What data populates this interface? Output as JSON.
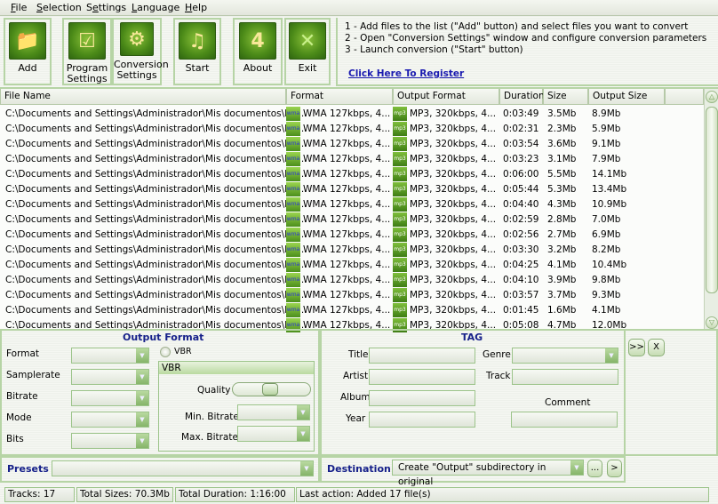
{
  "menu": [
    {
      "label": "File",
      "accel": "F",
      "rest": "ile"
    },
    {
      "label": "Selection",
      "accel": "S",
      "rest": "election"
    },
    {
      "label": "Settings",
      "accel": "e",
      "pre": "S",
      "rest": "ttings"
    },
    {
      "label": "Language",
      "accel": "L",
      "rest": "anguage"
    },
    {
      "label": "Help",
      "accel": "H",
      "rest": "elp"
    }
  ],
  "toolbar": {
    "add": {
      "label": "Add",
      "icon": "add-folder-music-icon"
    },
    "program_settings": {
      "line1": "Program",
      "line2": "Settings",
      "icon": "program-settings-icon"
    },
    "conversion_settings": {
      "line1": "Conversion",
      "line2": "Settings",
      "icon": "conversion-settings-icon"
    },
    "start": {
      "label": "Start",
      "icon": "start-music-icon"
    },
    "about": {
      "label": "About",
      "icon": "about-icon"
    },
    "exit": {
      "label": "Exit",
      "icon": "exit-icon"
    }
  },
  "info": {
    "step1": "1 - Add files to the list (\"Add\" button) and select files you want to convert",
    "step2": "2 - Open \"Conversion Settings\" window and configure conversion parameters",
    "step3": "3 - Launch conversion (\"Start\" button)",
    "register": "Click Here To Register"
  },
  "columns": [
    "File Name",
    "Format",
    "Output Format",
    "Duration",
    "Size",
    "Output Size"
  ],
  "files": [
    {
      "name": "C:\\Documents and Settings\\Administrador\\Mis documentos\\Mi ...",
      "format": "WMA 127kbps, 4...",
      "output_format": "MP3, 320kbps, 4...",
      "duration": "0:03:49",
      "size": "3.5Mb",
      "output_size": "8.9Mb"
    },
    {
      "name": "C:\\Documents and Settings\\Administrador\\Mis documentos\\Mi ...",
      "format": "WMA 127kbps, 4...",
      "output_format": "MP3, 320kbps, 4...",
      "duration": "0:02:31",
      "size": "2.3Mb",
      "output_size": "5.9Mb"
    },
    {
      "name": "C:\\Documents and Settings\\Administrador\\Mis documentos\\Mi ...",
      "format": "WMA 127kbps, 4...",
      "output_format": "MP3, 320kbps, 4...",
      "duration": "0:03:54",
      "size": "3.6Mb",
      "output_size": "9.1Mb"
    },
    {
      "name": "C:\\Documents and Settings\\Administrador\\Mis documentos\\Mi ...",
      "format": "WMA 127kbps, 4...",
      "output_format": "MP3, 320kbps, 4...",
      "duration": "0:03:23",
      "size": "3.1Mb",
      "output_size": "7.9Mb"
    },
    {
      "name": "C:\\Documents and Settings\\Administrador\\Mis documentos\\Mi ...",
      "format": "WMA 127kbps, 4...",
      "output_format": "MP3, 320kbps, 4...",
      "duration": "0:06:00",
      "size": "5.5Mb",
      "output_size": "14.1Mb"
    },
    {
      "name": "C:\\Documents and Settings\\Administrador\\Mis documentos\\Mi ...",
      "format": "WMA 127kbps, 4...",
      "output_format": "MP3, 320kbps, 4...",
      "duration": "0:05:44",
      "size": "5.3Mb",
      "output_size": "13.4Mb"
    },
    {
      "name": "C:\\Documents and Settings\\Administrador\\Mis documentos\\Mi ...",
      "format": "WMA 127kbps, 4...",
      "output_format": "MP3, 320kbps, 4...",
      "duration": "0:04:40",
      "size": "4.3Mb",
      "output_size": "10.9Mb"
    },
    {
      "name": "C:\\Documents and Settings\\Administrador\\Mis documentos\\Mi ...",
      "format": "WMA 127kbps, 4...",
      "output_format": "MP3, 320kbps, 4...",
      "duration": "0:02:59",
      "size": "2.8Mb",
      "output_size": "7.0Mb"
    },
    {
      "name": "C:\\Documents and Settings\\Administrador\\Mis documentos\\Mi ...",
      "format": "WMA 127kbps, 4...",
      "output_format": "MP3, 320kbps, 4...",
      "duration": "0:02:56",
      "size": "2.7Mb",
      "output_size": "6.9Mb"
    },
    {
      "name": "C:\\Documents and Settings\\Administrador\\Mis documentos\\Mi ...",
      "format": "WMA 127kbps, 4...",
      "output_format": "MP3, 320kbps, 4...",
      "duration": "0:03:30",
      "size": "3.2Mb",
      "output_size": "8.2Mb"
    },
    {
      "name": "C:\\Documents and Settings\\Administrador\\Mis documentos\\Mi ...",
      "format": "WMA 127kbps, 4...",
      "output_format": "MP3, 320kbps, 4...",
      "duration": "0:04:25",
      "size": "4.1Mb",
      "output_size": "10.4Mb"
    },
    {
      "name": "C:\\Documents and Settings\\Administrador\\Mis documentos\\Mi ...",
      "format": "WMA 127kbps, 4...",
      "output_format": "MP3, 320kbps, 4...",
      "duration": "0:04:10",
      "size": "3.9Mb",
      "output_size": "9.8Mb"
    },
    {
      "name": "C:\\Documents and Settings\\Administrador\\Mis documentos\\Mi ...",
      "format": "WMA 127kbps, 4...",
      "output_format": "MP3, 320kbps, 4...",
      "duration": "0:03:57",
      "size": "3.7Mb",
      "output_size": "9.3Mb"
    },
    {
      "name": "C:\\Documents and Settings\\Administrador\\Mis documentos\\Mi ...",
      "format": "WMA 127kbps, 4...",
      "output_format": "MP3, 320kbps, 4...",
      "duration": "0:01:45",
      "size": "1.6Mb",
      "output_size": "4.1Mb"
    },
    {
      "name": "C:\\Documents and Settings\\Administrador\\Mis documentos\\Mi ...",
      "format": "WMA 127kbps, 4...",
      "output_format": "MP3, 320kbps, 4...",
      "duration": "0:05:08",
      "size": "4.7Mb",
      "output_size": "12.0Mb"
    }
  ],
  "format_icons": {
    "input": "wma",
    "output": "mp3"
  },
  "output_format": {
    "title": "Output Format",
    "labels": {
      "format": "Format",
      "samplerate": "Samplerate",
      "bitrate": "Bitrate",
      "mode": "Mode",
      "bits": "Bits"
    },
    "vbr_checkbox": "VBR",
    "vbr_group": "VBR",
    "quality": "Quality",
    "quality_value": 0.48,
    "min_bitrate": "Min. Bitrate",
    "max_bitrate": "Max. Bitrate"
  },
  "tag": {
    "title": "TAG",
    "labels": {
      "title": "Title",
      "artist": "Artist",
      "album": "Album",
      "year": "Year",
      "genre": "Genre",
      "track": "Track",
      "comment": "Comment"
    }
  },
  "side_buttons": {
    "forward": ">>",
    "clear": "X"
  },
  "presets": {
    "label": "Presets",
    "value": ""
  },
  "destination": {
    "label": "Destination",
    "value": "Create \"Output\" subdirectory in original",
    "browse": "...",
    "go": ">"
  },
  "status": {
    "tracks": "Tracks: 17",
    "total_sizes": "Total Sizes: 70.3Mb",
    "total_duration": "Total Duration: 1:16:00",
    "last_action": "Last action: Added 17 file(s)"
  },
  "colors": {
    "accent": "#16208a",
    "link": "#1a1ab0",
    "border": "#b6d4a5"
  }
}
